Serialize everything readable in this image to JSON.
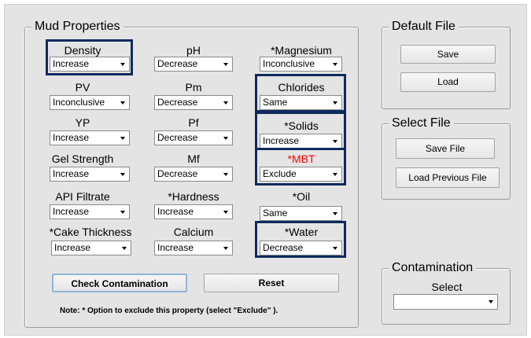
{
  "mud": {
    "title": "Mud Properties",
    "properties": [
      {
        "id": "density",
        "label": "Density",
        "value": "Increase"
      },
      {
        "id": "ph",
        "label": "pH",
        "value": "Decrease"
      },
      {
        "id": "magnesium",
        "label": "*Magnesium",
        "value": "Inconclusive"
      },
      {
        "id": "pv",
        "label": "PV",
        "value": "Inconclusive"
      },
      {
        "id": "pm",
        "label": "Pm",
        "value": "Decrease"
      },
      {
        "id": "chlorides",
        "label": "Chlorides",
        "value": "Same"
      },
      {
        "id": "yp",
        "label": "YP",
        "value": "Increase"
      },
      {
        "id": "pf",
        "label": "Pf",
        "value": "Decrease"
      },
      {
        "id": "solids",
        "label": "*Solids",
        "value": "Increase"
      },
      {
        "id": "gel-strength",
        "label": "Gel Strength",
        "value": "Increase"
      },
      {
        "id": "mf",
        "label": "Mf",
        "value": "Decrease"
      },
      {
        "id": "mbt",
        "label": "*MBT",
        "value": "Exclude"
      },
      {
        "id": "api-filtrate",
        "label": "API Filtrate",
        "value": "Increase"
      },
      {
        "id": "hardness",
        "label": "*Hardness",
        "value": "Increase"
      },
      {
        "id": "oil",
        "label": "*Oil",
        "value": "Same"
      },
      {
        "id": "cake-thickness",
        "label": "*Cake Thickness",
        "value": "Increase"
      },
      {
        "id": "calcium",
        "label": "Calcium",
        "value": "Increase"
      },
      {
        "id": "water",
        "label": "*Water",
        "value": "Decrease"
      }
    ],
    "check_button": "Check Contamination",
    "reset_button": "Reset",
    "note": "Note: * Option to exclude this property (select \"Exclude\" )."
  },
  "default_file": {
    "title": "Default File",
    "save": "Save",
    "load": "Load"
  },
  "select_file": {
    "title": "Select File",
    "save": "Save File",
    "load_prev": "Load Previous File"
  },
  "contamination": {
    "title": "Contamination",
    "select_label": "Select",
    "select_value": ""
  },
  "colors": {
    "highlight": "#0f2a5e",
    "warning_label": "#ff0000"
  }
}
